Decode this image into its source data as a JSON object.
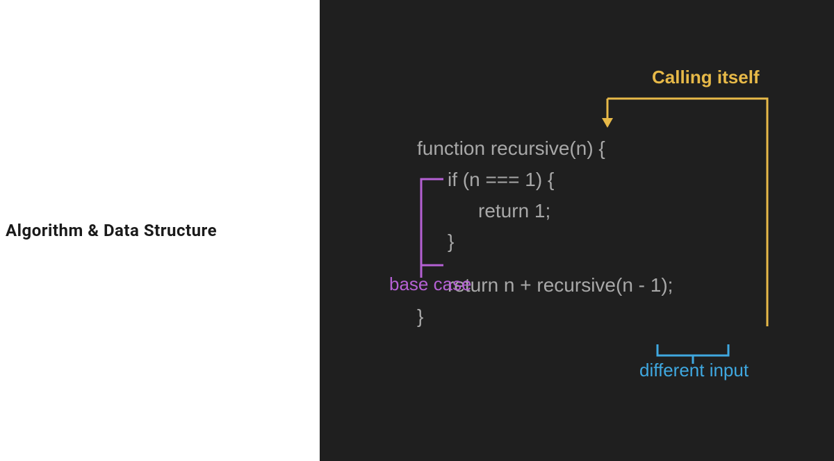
{
  "left": {
    "heading": "Algorithm & Data Structure"
  },
  "code": {
    "line1": "function recursive(n) {",
    "line2": "if (n === 1) {",
    "line3": "return 1;",
    "line4": "}",
    "line5": "return n + recursive(n - 1);",
    "line6": "}"
  },
  "annotations": {
    "calling_itself": "Calling itself",
    "base_case": "base case",
    "different_input": "different input"
  },
  "colors": {
    "bg_dark": "#1f1f1f",
    "code_text": "#a8a8a8",
    "yellow": "#e7b948",
    "purple": "#b560d4",
    "blue": "#3fa8e0"
  }
}
